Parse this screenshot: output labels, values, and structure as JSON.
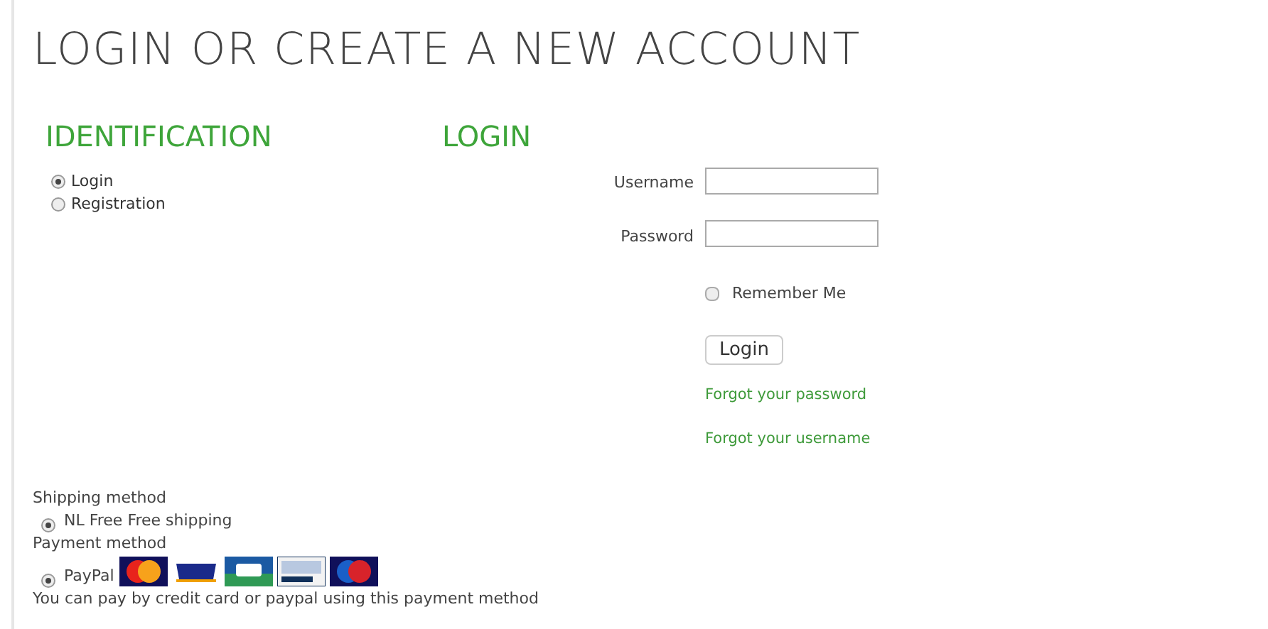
{
  "title": "LOGIN OR CREATE A NEW ACCOUNT",
  "identification": {
    "heading": "IDENTIFICATION",
    "options": [
      {
        "label": "Login",
        "selected": true
      },
      {
        "label": "Registration",
        "selected": false
      }
    ]
  },
  "login": {
    "heading": "LOGIN",
    "fields": [
      {
        "label": "Username"
      },
      {
        "label": "Password"
      }
    ],
    "remember": {
      "label": "Remember Me",
      "checked": false
    },
    "button": "Login",
    "links": [
      "Forgot your password",
      "Forgot your username"
    ]
  },
  "shipping": {
    "heading": "Shipping method",
    "options": [
      {
        "label": "NL Free Free shipping",
        "selected": true
      }
    ]
  },
  "payment": {
    "heading": "Payment method",
    "options": [
      {
        "label": "PayPal",
        "selected": true
      }
    ],
    "note": "You can pay by credit card or paypal using this payment method"
  }
}
